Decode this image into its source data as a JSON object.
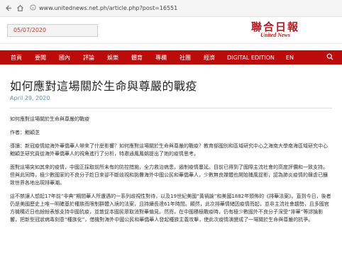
{
  "browser": {
    "back_icon": "arrow-left-icon",
    "home_icon": "home-icon",
    "lock_icon": "info-icon",
    "url": "www.unitednews.net.ph/article.php?post=16551"
  },
  "header": {
    "date_value": "05/07/2020",
    "logo_cn": "聯合日報",
    "logo_en": "United News"
  },
  "nav": {
    "items": [
      "首頁",
      "要聞",
      "國內",
      "評論",
      "娛樂",
      "體育",
      "專欄",
      "社團",
      "經濟",
      "DIGITAL EDITION",
      "EN"
    ],
    "search_icon": "search-icon"
  },
  "article": {
    "title": "如何應對這場關於生命與尊嚴的戰疫",
    "date": "April 29, 2020",
    "subtitle": "如何應對這場關於生命與尊嚴的戰疫",
    "author": "作者：鮑穎芝",
    "paragraphs": [
      "導讀：新冠疫情給海外華僑華人帶來了什麼影響？如何應對這場關於生命與尊嚴的戰疫？教育部國別和區域研究中心之海南大學南海區域研究中心鮑穎芝研究員從海外華僑華人的視角進行了分析，特邀通鳳鳳朝提出了她的疫情思考。",
      "面對這場突如其來的疫情，中國正採取前所未有的防控措施，全力救治病患，遏制疫情蔓延。目前已得到了國際主流社會的高度評價和一致支持。但與此同時，極少數國家的不良分子趁日來卻不斷歧視和挑釁海外中國公民和華僑華人，少數無良媒體也開始捕風捉影，認為肺炎疫情的肆虐已釀致世界各地出現排華潮。",
      "這不禁讓人想起17年前“非典”期間華人所遭遇的一系列歧視性對待，以及19世紀美國“黃禍論”和美國1882年頒佈的《排華法案》。直到今日，後者仍是美國歷史上唯一明確基於種族而限制群體入境的法案，且持續長達61年時間。顯然，此次排華情緒因疫情而起，並非主流社會趨勢，且多國官方機構近日也紛紛表態支持中國抗疫，並敦促本國民眾取消對華偏見。然而，在中國積極戰疫時，仍有極少數國外不良分子深受“排華”等謬論影響，把新型冠狀病毒刻意“種族化”，借機對海外中國公民和華僑華人發起種族主義攻擊，使此次疫情演變成了一場關於生命與尊嚴的抗爭。"
    ]
  }
}
